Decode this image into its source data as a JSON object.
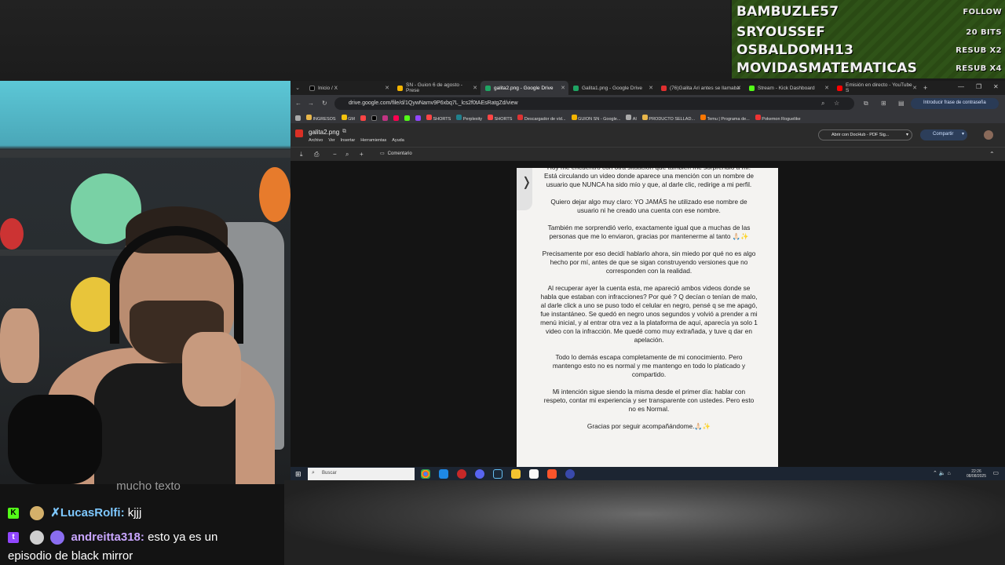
{
  "alerts": [
    {
      "name": "BAMBUZLE57",
      "badge": "FOLLOW"
    },
    {
      "name": "SRYOUSSEF",
      "badge": "20 BITS"
    },
    {
      "name": "OSBALDOMH13",
      "badge": "RESUB X2"
    },
    {
      "name": "MOVIDASMATEMATICAS",
      "badge": "RESUB X4"
    }
  ],
  "browser": {
    "tabs": [
      {
        "label": "Inicio / X",
        "color": "#000000"
      },
      {
        "label": "SN - Guion 6 de agosto - Prese",
        "color": "#f4b400"
      },
      {
        "label": "galita2.png - Google Drive",
        "color": "#1fa463"
      },
      {
        "label": "Galita1.png - Google Drive",
        "color": "#1fa463"
      },
      {
        "label": "(76)Galita Ari antes se llamaba",
        "color": "#e02f2f"
      },
      {
        "label": "Stream - Kick Dashboard",
        "color": "#53fc18"
      },
      {
        "label": "Emisión en directo - YouTube S",
        "color": "#ff0000"
      }
    ],
    "url": "drive.google.com/file/d/1QywNamv9P6xbq7L_lcs2f0tAEsRatgZd/view",
    "passkey_label": "Introducir frase de contraseña",
    "bookmarks": [
      "INGRESOS",
      "GM",
      "SHORTS",
      "Perplexity",
      "SHORTS",
      "Descargador de víd...",
      "GUION SN - Google...",
      "AI",
      "PRODUCTO SELLAD...",
      "Temu | Programa de...",
      "Pokemon Roguelike"
    ],
    "doc_title": "galita2.png",
    "doc_menu": [
      "Archivo",
      "Ver",
      "Insertar",
      "Herramientas",
      "Ayuda"
    ],
    "open_with": "Abrir con DocHub - PDF Sig...",
    "share": "Compartir",
    "comment": "Comentario",
    "page_paragraphs": [
      "Hoy me encuentro con otra situación que también me sorprendió a mí. Está circulando un video donde aparece una mención con un nombre de usuario que NUNCA ha sido mío y que, al darle clic, redirige a mi perfil.",
      "Quiero dejar algo muy claro: YO JAMÁS he utilizado ese nombre de usuario ni he creado una cuenta con ese nombre.",
      "También me sorprendió verlo, exactamente igual que a muchas de las personas que me lo enviaron, gracias por mantenerme al tanto 🙏🏻✨",
      "Precisamente por eso decidí hablarlo ahora, sin miedo por qué no es algo hecho por mí, antes de que se sigan construyendo versiones que no corresponden con la realidad.",
      "Al recuperar ayer la cuenta esta, me apareció ambos videos donde se habla que estaban con infracciones? Por qué ? Q decían o tenían de malo, al darle click a uno se puso todo el celular en negro, pensé q se me apagó, fue instantáneo. Se quedó en negro unos segundos y volvió a prender a mi menú inicial, y al entrar otra vez a la plataforma de aquí, aparecía ya solo 1 video con la infracción. Me quedé como muy extrañada, y tuve q dar en apelación.",
      "Todo lo demás escapa completamente de mi conocimiento. Pero mantengo esto no es normal y me mantengo en todo lo platicado y compartido.",
      "Mi intención sigue siendo la misma desde el primer día: hablar con respeto, contar mi experiencia y ser transparente con ustedes. Pero esto no es Normal.",
      "Gracias por seguir acompañándome.🙏🏻✨"
    ],
    "taskbar_search": "Buscar",
    "clock_time": "22:26",
    "clock_date": "08/08/2025"
  },
  "chat": {
    "line0": {
      "text": "mucho texto"
    },
    "line1": {
      "user": "LucasRolfi",
      "user_color": "#7ec8ff",
      "message": "kjjj"
    },
    "line2": {
      "user": "andreitta318",
      "user_color": "#c9a6ff",
      "message": "esto ya es un",
      "message_cont": "episodio de black mirror"
    }
  }
}
